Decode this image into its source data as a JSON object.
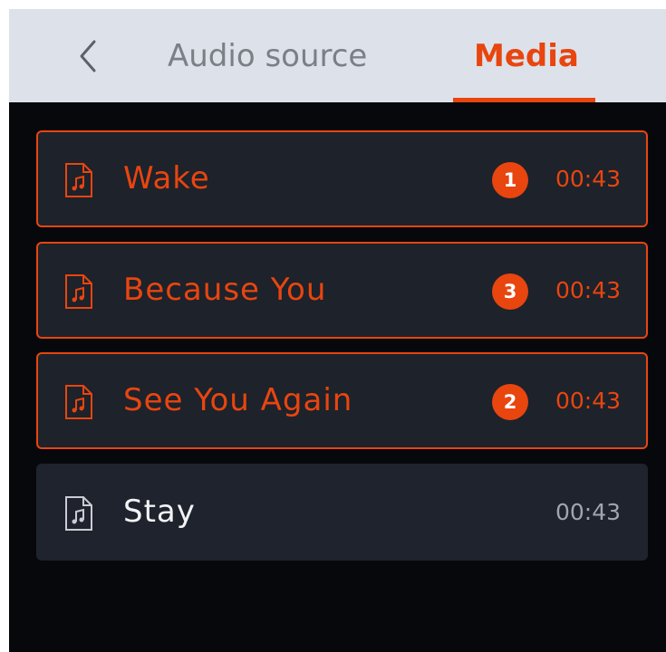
{
  "header": {
    "back_icon": "chevron-left-icon",
    "tabs": [
      {
        "label": "Audio source",
        "selected": false
      },
      {
        "label": "Media",
        "selected": true
      }
    ]
  },
  "colors": {
    "accent": "#e8450f",
    "background": "#06080b",
    "header_bg": "#dde2ea",
    "item_bg": "#1e232d",
    "inactive_tab_text": "#7b7f86"
  },
  "media": {
    "items": [
      {
        "title": "Wake",
        "duration": "00:43",
        "badge": "1",
        "selected": true,
        "icon": "music-file-icon"
      },
      {
        "title": "Because You",
        "duration": "00:43",
        "badge": "3",
        "selected": true,
        "icon": "music-file-icon"
      },
      {
        "title": "See You Again",
        "duration": "00:43",
        "badge": "2",
        "selected": true,
        "icon": "music-file-icon"
      },
      {
        "title": "Stay",
        "duration": "00:43",
        "badge": null,
        "selected": false,
        "icon": "music-file-icon"
      }
    ]
  }
}
